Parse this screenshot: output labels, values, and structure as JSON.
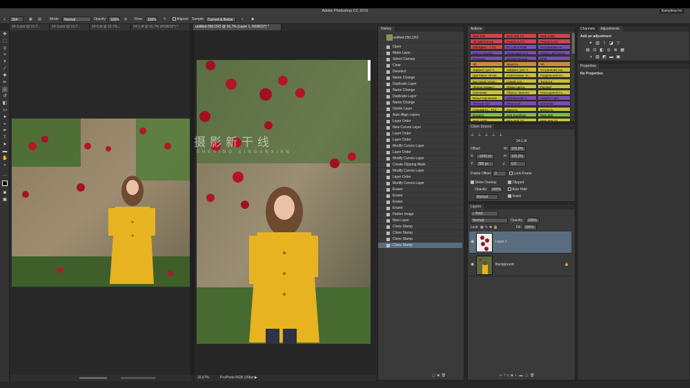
{
  "app": {
    "window_title": "Adobe Photoshop CC 2015",
    "user_name": "Kamyleva Ira"
  },
  "options_bar": {
    "brush_size": "354",
    "mode_label": "Mode:",
    "mode_value": "Normal",
    "opacity_label": "Opacity:",
    "opacity_value": "100%",
    "flow_label": "Flow:",
    "flow_value": "100%",
    "aligned_label": "Aligned",
    "sample_label": "Sample:",
    "sample_value": "Current & Below"
  },
  "doc_tabs": [
    "24-2.psd @ 16,7...",
    "24-3.psd @ 16,7...",
    "24-5.tif @ 16,7%...",
    "24-1.tif @ 16,7% (RGB/16*) *",
    "untitled-250.CR2 @ 16,7% (Layer 1, RGB/16*) *"
  ],
  "tooltip": "untitled-250.CR2 @ 16,7% (Layer 1, RGB/16*) *",
  "status": {
    "zoom": "16,67%",
    "profile": "ProPhoto RGB (16bpc)"
  },
  "watermark": {
    "cn": "摄影新干线",
    "en": "SHEYING XINGANXIAN"
  },
  "history": {
    "title": "History",
    "snapshot": "untitled-250.CR2",
    "items": [
      "Open",
      "Make Layer",
      "Select Canvas",
      "Clear",
      "Deselect",
      "Name Change",
      "Duplicate Layer",
      "Name Change",
      "Duplicate Layer",
      "Name Change",
      "Delete Layer",
      "Auto-Align Layers",
      "Layer Order",
      "New Curves Layer",
      "Layer Order",
      "Layer Order",
      "Modify Curves Layer",
      "Layer Order",
      "Modify Curves Layer",
      "Create Clipping Mask",
      "Modify Curves Layer",
      "Layer Order",
      "Modify Curves Layer",
      "Eraser",
      "Eraser",
      "Eraser",
      "Eraser",
      "Flatten Image",
      "New Layer",
      "Clone Stamp",
      "Clone Stamp",
      "Clone Stamp",
      "Clone Stamp"
    ]
  },
  "actions": {
    "title": "Actions",
    "buttons": [
      {
        "label": "Web 900",
        "color": "#c9464e"
      },
      {
        "label": "Web 900 (7)",
        "color": "#c9464e"
      },
      {
        "label": "Web 1400",
        "color": "#c9464e"
      },
      {
        "label": "Чёткий контур",
        "color": "#c9464e"
      },
      {
        "label": "Резкость (7)",
        "color": "#c9464e"
      },
      {
        "label": "Резкость (2)",
        "color": "#c9464e"
      },
      {
        "label": "Объедин... + F1",
        "color": "#c9464e"
      },
      {
        "label": "Из Lab в RGB",
        "color": "#7b4fae"
      },
      {
        "label": "Устранение не...",
        "color": "#7b4fae"
      },
      {
        "label": "Свето-тенево...",
        "color": "#7b4fae"
      },
      {
        "label": "Телесный отте...",
        "color": "#7b4fae"
      },
      {
        "label": "Убрать желтизну",
        "color": "#7b4fae"
      },
      {
        "label": "Румянец",
        "color": "#7b4fae"
      },
      {
        "label": "Затемняющий...",
        "color": "#7b4fae"
      },
      {
        "label": "МЧР",
        "color": "#7b4fae"
      },
      {
        "label": "Чб",
        "color": "#d08a3a"
      },
      {
        "label": "Яркость",
        "color": "#d08a3a"
      },
      {
        "label": "Чб",
        "color": "#d08a3a"
      },
      {
        "label": "Эффект для Ч...",
        "color": "#c7c23b"
      },
      {
        "label": "Эффект для Ч...",
        "color": "#c7c23b"
      },
      {
        "label": "Устранение шу...",
        "color": "#c7c23b"
      },
      {
        "label": "Цветовые пятна",
        "color": "#c7c23b"
      },
      {
        "label": "Осветление те...",
        "color": "#c7c23b"
      },
      {
        "label": "Раздельный ко...",
        "color": "#c7c23b"
      },
      {
        "label": "Быстрый склер...",
        "color": "#c7c23b"
      },
      {
        "label": "Синий хол...",
        "color": "#c7c23b"
      },
      {
        "label": "Теплота",
        "color": "#c7c23b"
      },
      {
        "label": "Легкое размыт...",
        "color": "#c7c23b"
      },
      {
        "label": "Яркие цвета",
        "color": "#c7c23b"
      },
      {
        "label": "Рассвет",
        "color": "#c7c23b"
      },
      {
        "label": "Свечение",
        "color": "#c7c23b"
      },
      {
        "label": "Убрать лишнее",
        "color": "#c7c23b"
      },
      {
        "label": "Насыщенность...",
        "color": "#c7c23b"
      },
      {
        "label": "Виньетирование",
        "color": "#c7c23b"
      },
      {
        "label": "Затемнение и...",
        "color": "#7b4fae"
      },
      {
        "label": "Magical night",
        "color": "#7b4fae"
      },
      {
        "label": "Тёплый тон",
        "color": "#7b4fae"
      },
      {
        "label": "МКносолг",
        "color": "#7b4fae"
      },
      {
        "label": "свечение",
        "color": "#7b4fae"
      },
      {
        "label": "стандартн... F11",
        "color": "#c7c23b"
      },
      {
        "label": "яркость",
        "color": "#c7c23b"
      },
      {
        "label": "мягкость",
        "color": "#c7c23b"
      },
      {
        "label": "Dreamy",
        "color": "#7fbf4a"
      },
      {
        "label": "Soft Sunshine",
        "color": "#7fbf4a"
      },
      {
        "label": "Web 900",
        "color": "#7fbf4a"
      },
      {
        "label": "Web 1400",
        "color": "#c7c23b"
      },
      {
        "label": "Web 900 (2)",
        "color": "#c7c23b"
      },
      {
        "label": "Web 900 (2)",
        "color": "#c7c23b"
      }
    ]
  },
  "clone_source": {
    "title": "Clone Source",
    "source_file": "24-1.tif",
    "offset_label": "Offset:",
    "w_label": "W:",
    "w_value": "100,0%",
    "x_label": "X:",
    "x_value": "-1642 px",
    "h_label": "H:",
    "h_value": "100,0%",
    "y_label": "Y:",
    "y_value": "385 px",
    "angle_value": "0,0",
    "frame_offset_label": "Frame Offset:",
    "frame_offset_value": "0",
    "lock_frame_label": "Lock Frame",
    "show_overlay_label": "Show Overlay",
    "clipped_label": "Clipped",
    "opacity_label": "Opacity:",
    "opacity_value": "100%",
    "auto_hide_label": "Auto Hide",
    "mode_value": "Normal",
    "invert_label": "Invert"
  },
  "layers": {
    "title": "Layers",
    "kind_value": "Kind",
    "blend_value": "Normal",
    "opacity_label": "Opacity:",
    "opacity_value": "100%",
    "lock_label": "Lock:",
    "fill_label": "Fill:",
    "fill_value": "100%",
    "items": [
      {
        "name": "Layer 1",
        "selected": true
      },
      {
        "name": "Background",
        "selected": false
      }
    ]
  },
  "right_panel": {
    "tab_channels": "Channels",
    "tab_adjustments": "Adjustments",
    "add_adjustment": "Add an adjustment",
    "properties_title": "Properties",
    "no_properties": "No Properties"
  },
  "icons": [
    "move-icon",
    "marquee-icon",
    "lasso-icon",
    "quick-select-icon",
    "crop-icon",
    "eyedropper-icon",
    "healing-icon",
    "brush-icon",
    "clone-stamp-icon",
    "history-brush-icon",
    "eraser-icon",
    "gradient-icon",
    "blur-icon",
    "dodge-icon",
    "pen-icon",
    "type-icon",
    "path-select-icon",
    "shape-icon",
    "hand-icon",
    "zoom-icon"
  ]
}
